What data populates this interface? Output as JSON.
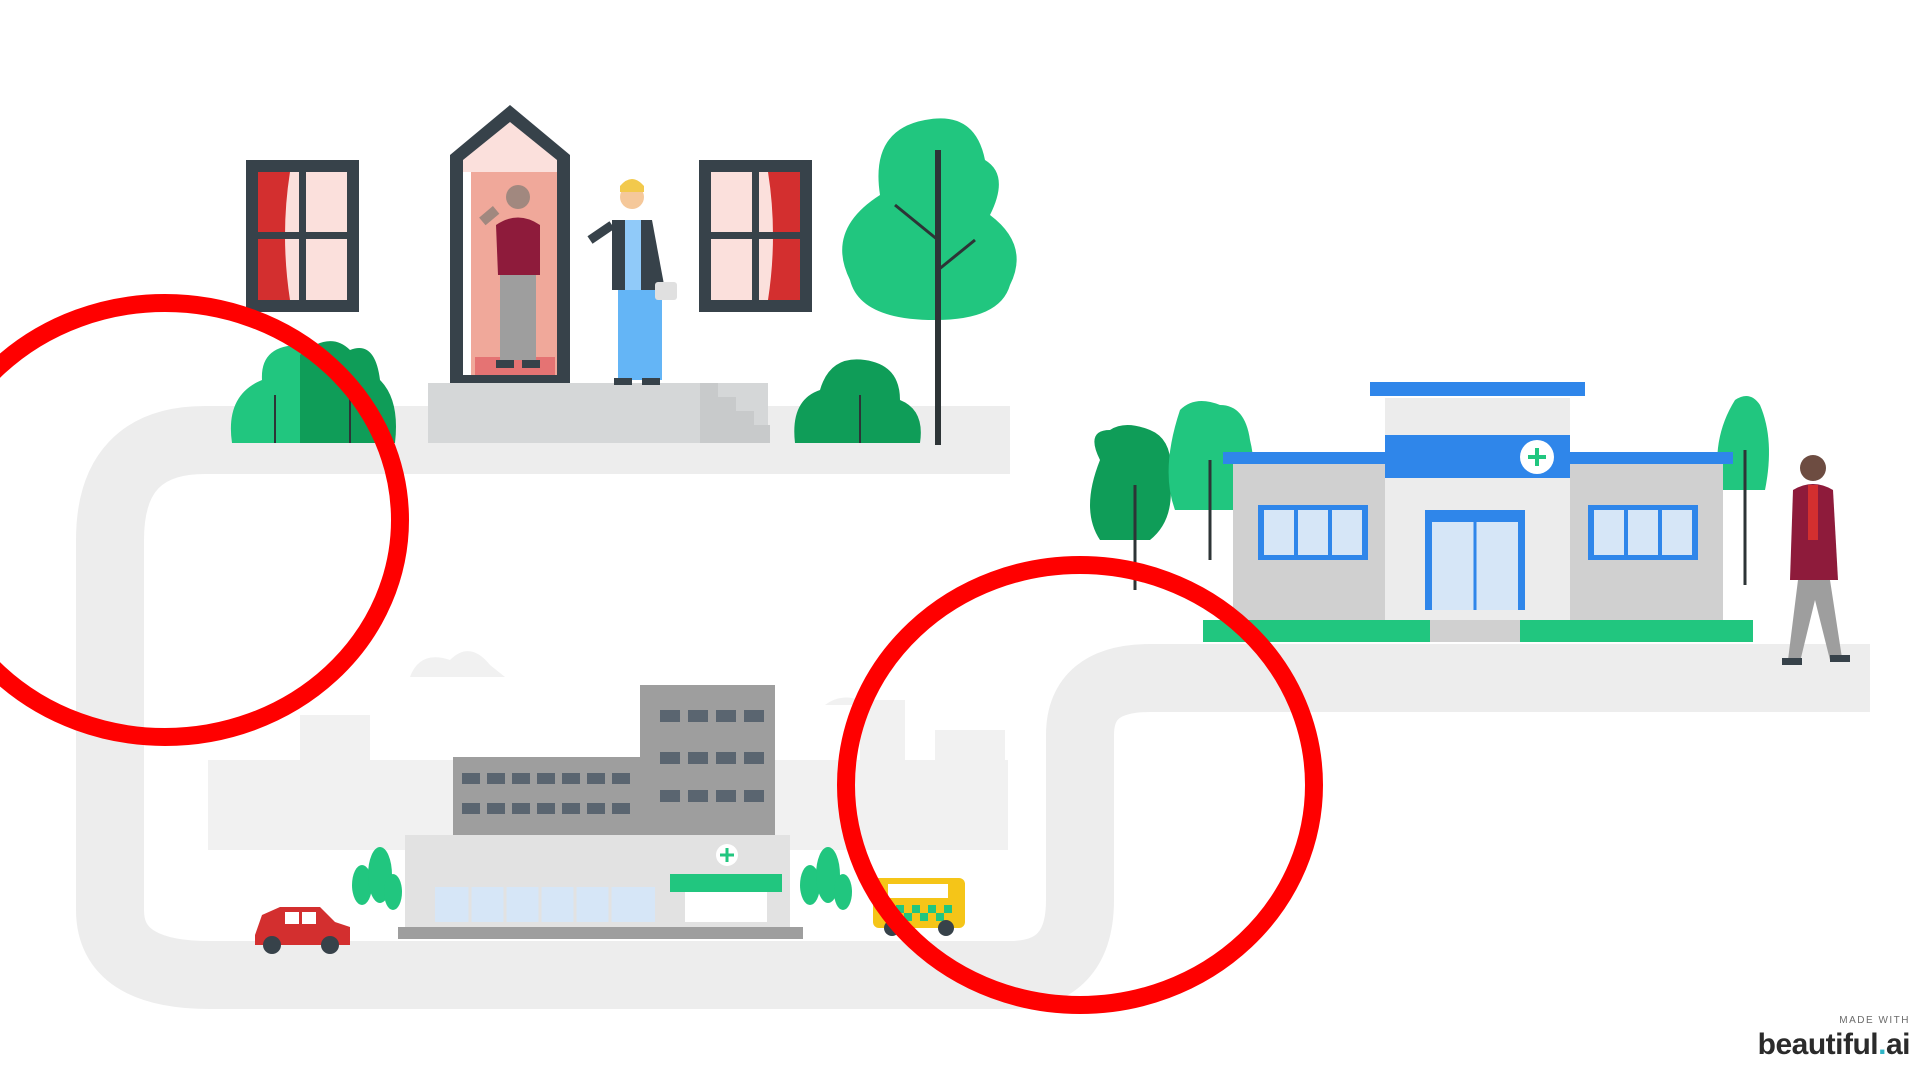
{
  "brand": {
    "made_with": "MADE WITH",
    "name": "beautiful",
    "dot": ".",
    "tld": "ai"
  },
  "colors": {
    "road": "#ededed",
    "tree": "#21c67f",
    "tree_dark": "#0f9d58",
    "trunk": "#2d3436",
    "circle": "#ff0000",
    "clinic_blue": "#2f86ea",
    "window_frame": "#37424a"
  },
  "icons": [
    "house-icon",
    "hospital-icon",
    "clinic-icon",
    "car-icon",
    "ambulance-icon",
    "tree-icon",
    "person-icon",
    "medical-cross-icon"
  ]
}
